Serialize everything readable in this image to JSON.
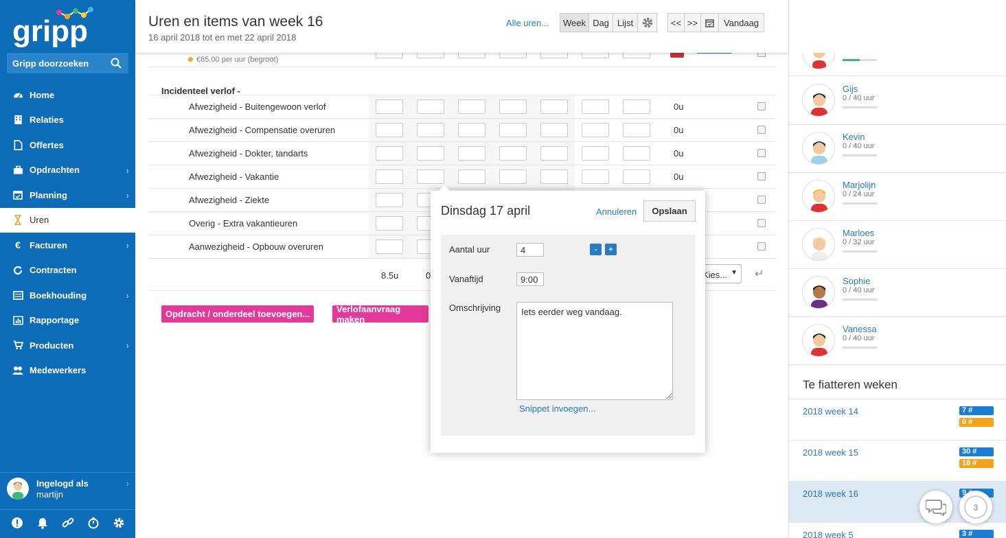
{
  "sidebar": {
    "logo_text": "gripp",
    "search_label": "Gripp doorzoeken",
    "nav": [
      {
        "label": "Home",
        "icon": "dashboard-icon",
        "chevron": false,
        "active": false
      },
      {
        "label": "Relaties",
        "icon": "building-icon",
        "chevron": false,
        "active": false
      },
      {
        "label": "Offertes",
        "icon": "document-icon",
        "chevron": false,
        "active": false
      },
      {
        "label": "Opdrachten",
        "icon": "briefcase-icon",
        "chevron": true,
        "active": false
      },
      {
        "label": "Planning",
        "icon": "calendar-icon",
        "chevron": true,
        "active": false
      },
      {
        "label": "Uren",
        "icon": "hourglass-icon",
        "chevron": false,
        "active": true
      },
      {
        "label": "Facturen",
        "icon": "euro-icon",
        "chevron": true,
        "active": false
      },
      {
        "label": "Contracten",
        "icon": "refresh-icon",
        "chevron": false,
        "active": false
      },
      {
        "label": "Boekhouding",
        "icon": "ledger-icon",
        "chevron": true,
        "active": false
      },
      {
        "label": "Rapportage",
        "icon": "bar-chart-icon",
        "chevron": false,
        "active": false
      },
      {
        "label": "Producten",
        "icon": "cart-icon",
        "chevron": true,
        "active": false
      },
      {
        "label": "Medewerkers",
        "icon": "users-icon",
        "chevron": false,
        "active": false
      }
    ],
    "user": {
      "line1": "Ingelogd als",
      "line2": "martijn"
    },
    "footer_icons": [
      "alert-icon",
      "bell-icon",
      "link-icon",
      "stopwatch-icon",
      "gear-icon"
    ]
  },
  "header": {
    "title": "Uren en items van week 16",
    "subtitle": "16 april 2018 tot en met 22 april 2018",
    "all_hours": "Alle uren...",
    "view_week": "Week",
    "view_day": "Dag",
    "view_list": "Lijst",
    "prev": "<<",
    "next": ">>",
    "today": "Vandaag"
  },
  "grid": {
    "budget": "€65,00 per uur (begroot)",
    "section": "Incidenteel verlof -",
    "rows": [
      {
        "label": "Afwezigheid - Buitengewoon verlof",
        "total": "0u"
      },
      {
        "label": "Afwezigheid - Compensatie overuren",
        "total": "0u"
      },
      {
        "label": "Afwezigheid - Dokter, tandarts",
        "total": "0u"
      },
      {
        "label": "Afwezigheid - Vakantie",
        "total": "0u"
      },
      {
        "label": "Afwezigheid - Ziekte",
        "total": ""
      },
      {
        "label": "Overig - Extra vakantieuren",
        "total": ""
      },
      {
        "label": "Aanwezigheid - Opbouw overuren",
        "total": ""
      }
    ],
    "sum_monday": "8.5u",
    "sum_tuesday_partial": "0",
    "select_value": "Kies...",
    "add_assignment": "Opdracht / onderdeel toevoegen...",
    "leave_request": "Verlofaanvraag maken"
  },
  "popup": {
    "title": "Dinsdag 17 april",
    "cancel": "Annuleren",
    "save": "Opslaan",
    "hours_label": "Aantal uur",
    "hours_value": "4",
    "minus": "-",
    "plus": "+",
    "from_label": "Vanaftijd",
    "from_value": "9:00",
    "desc_label": "Omschrijving",
    "desc_value": "Iets eerder weg vandaag.",
    "snippet": "Snippet invoegen..."
  },
  "team": [
    {
      "name": "Gijs",
      "hours": "0 / 40 uur",
      "progress": 0
    },
    {
      "name": "Kevin",
      "hours": "0 / 40 uur",
      "progress": 0
    },
    {
      "name": "Marjolijn",
      "hours": "0 / 24 uur",
      "progress": 0
    },
    {
      "name": "Marloes",
      "hours": "0 / 32 uur",
      "progress": 0
    },
    {
      "name": "Sophie",
      "hours": "0 / 40 uur",
      "progress": 0
    },
    {
      "name": "Vanessa",
      "hours": "0 / 40 uur",
      "progress": 0
    }
  ],
  "approve": {
    "title": "Te fiatteren weken",
    "weeks": [
      {
        "label": "2018 week 14",
        "blue": "7 #",
        "orange": "0 #",
        "selected": false
      },
      {
        "label": "2018 week 15",
        "blue": "30 #",
        "orange": "18 #",
        "selected": false
      },
      {
        "label": "2018 week 16",
        "blue": "9 #",
        "orange": "",
        "selected": true
      },
      {
        "label": "2018 week 5",
        "blue": "3 #",
        "orange": "",
        "selected": false
      }
    ]
  },
  "chat_badge": "3",
  "colors": {
    "sidebar": "#0d6cb8",
    "link": "#2b7ac4",
    "pink": "#e3399a",
    "badge_blue": "#1a7fd4",
    "badge_orange": "#f5a31a"
  }
}
